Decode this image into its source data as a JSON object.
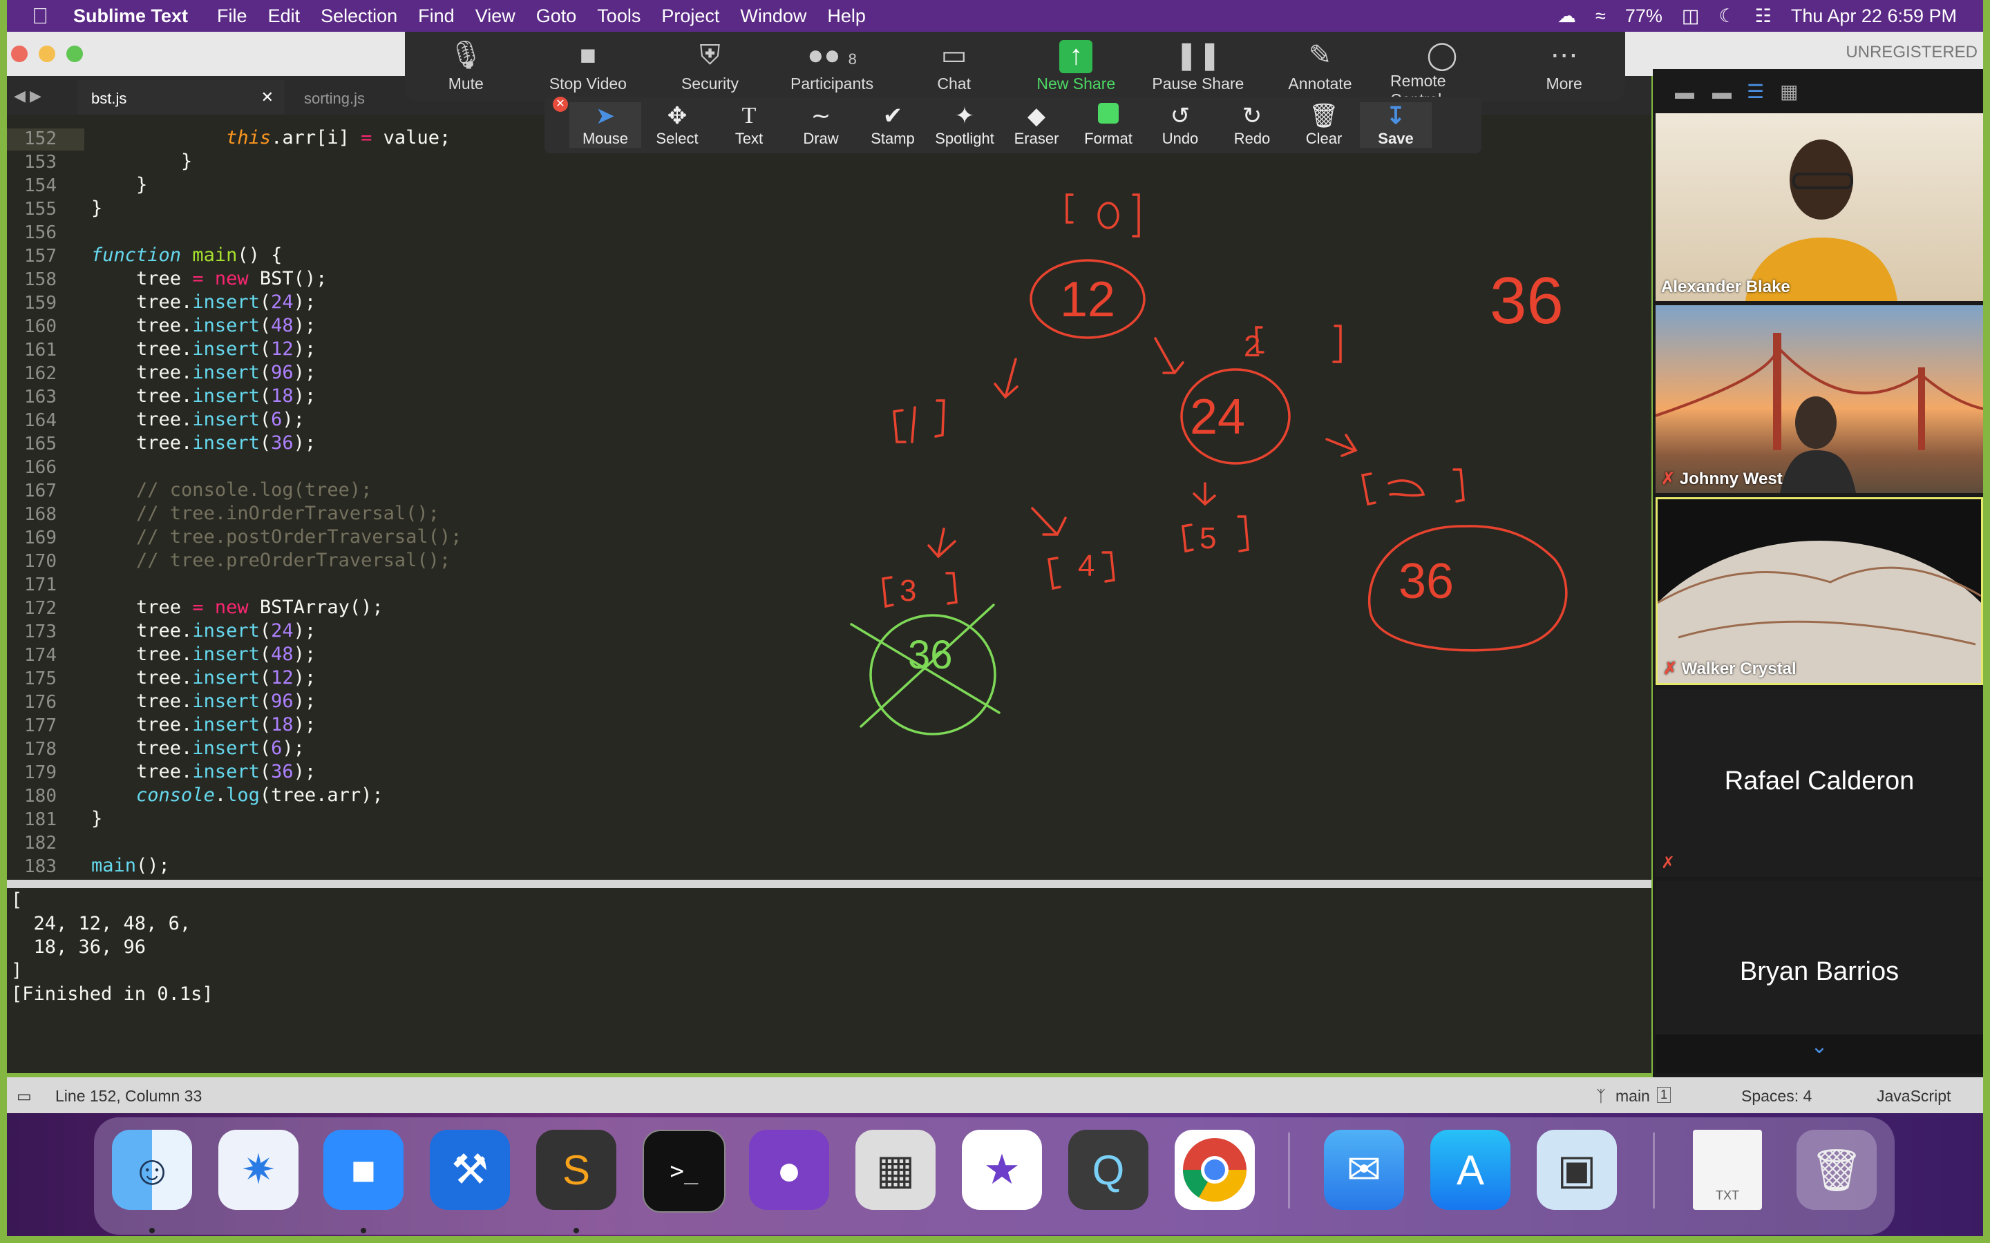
{
  "menubar": {
    "app": "Sublime Text",
    "items": [
      "File",
      "Edit",
      "Selection",
      "Find",
      "View",
      "Goto",
      "Tools",
      "Project",
      "Window",
      "Help"
    ],
    "battery": "77%",
    "datetime": "Thu Apr 22  6:59 PM"
  },
  "window": {
    "unregistered": "UNREGISTERED",
    "tabs": [
      "bst.js",
      "sorting.js"
    ]
  },
  "zoom_toolbar": {
    "items": [
      {
        "label": "Mute",
        "icon": "microphone-icon"
      },
      {
        "label": "Stop Video",
        "icon": "video-camera-icon"
      },
      {
        "label": "Security",
        "icon": "shield-icon"
      },
      {
        "label": "Participants",
        "icon": "participants-icon",
        "count": "8"
      },
      {
        "label": "Chat",
        "icon": "chat-icon"
      },
      {
        "label": "New Share",
        "icon": "share-arrow-icon"
      },
      {
        "label": "Pause Share",
        "icon": "pause-icon"
      },
      {
        "label": "Annotate",
        "icon": "pencil-icon"
      },
      {
        "label": "Remote Control",
        "icon": "mouse-icon"
      },
      {
        "label": "More",
        "icon": "more-dots-icon"
      }
    ]
  },
  "annotate_toolbar": {
    "items": [
      "Mouse",
      "Select",
      "Text",
      "Draw",
      "Stamp",
      "Spotlight",
      "Eraser",
      "Format",
      "Undo",
      "Redo",
      "Clear",
      "Save"
    ]
  },
  "editor": {
    "lines": [
      {
        "n": "152",
        "html": "            <span class='this'>this</span>.arr[i] <span class='kw'>=</span> value;"
      },
      {
        "n": "153",
        "html": "        }"
      },
      {
        "n": "154",
        "html": "    }"
      },
      {
        "n": "155",
        "html": "}"
      },
      {
        "n": "156",
        "html": ""
      },
      {
        "n": "157",
        "html": "<span class='it'>function</span> <span class='fn'>main</span>() {"
      },
      {
        "n": "158",
        "html": "    tree <span class='kw'>=</span> <span class='kw'>new</span> BST();"
      },
      {
        "n": "159",
        "html": "    tree.<span class='mt'>insert</span>(<span class='num'>24</span>);"
      },
      {
        "n": "160",
        "html": "    tree.<span class='mt'>insert</span>(<span class='num'>48</span>);"
      },
      {
        "n": "161",
        "html": "    tree.<span class='mt'>insert</span>(<span class='num'>12</span>);"
      },
      {
        "n": "162",
        "html": "    tree.<span class='mt'>insert</span>(<span class='num'>96</span>);"
      },
      {
        "n": "163",
        "html": "    tree.<span class='mt'>insert</span>(<span class='num'>18</span>);"
      },
      {
        "n": "164",
        "html": "    tree.<span class='mt'>insert</span>(<span class='num'>6</span>);"
      },
      {
        "n": "165",
        "html": "    tree.<span class='mt'>insert</span>(<span class='num'>36</span>);"
      },
      {
        "n": "166",
        "html": ""
      },
      {
        "n": "167",
        "html": "    <span class='cm'>// console.log(tree);</span>"
      },
      {
        "n": "168",
        "html": "    <span class='cm'>// tree.inOrderTraversal();</span>"
      },
      {
        "n": "169",
        "html": "    <span class='cm'>// tree.postOrderTraversal();</span>"
      },
      {
        "n": "170",
        "html": "    <span class='cm'>// tree.preOrderTraversal();</span>"
      },
      {
        "n": "171",
        "html": ""
      },
      {
        "n": "172",
        "html": "    tree <span class='kw'>=</span> <span class='kw'>new</span> BSTArray();"
      },
      {
        "n": "173",
        "html": "    tree.<span class='mt'>insert</span>(<span class='num'>24</span>);"
      },
      {
        "n": "174",
        "html": "    tree.<span class='mt'>insert</span>(<span class='num'>48</span>);"
      },
      {
        "n": "175",
        "html": "    tree.<span class='mt'>insert</span>(<span class='num'>12</span>);"
      },
      {
        "n": "176",
        "html": "    tree.<span class='mt'>insert</span>(<span class='num'>96</span>);"
      },
      {
        "n": "177",
        "html": "    tree.<span class='mt'>insert</span>(<span class='num'>18</span>);"
      },
      {
        "n": "178",
        "html": "    tree.<span class='mt'>insert</span>(<span class='num'>6</span>);"
      },
      {
        "n": "179",
        "html": "    tree.<span class='mt'>insert</span>(<span class='num'>36</span>);"
      },
      {
        "n": "180",
        "html": "    <span class='it'>console</span>.<span class='mt'>log</span>(tree.arr);"
      },
      {
        "n": "181",
        "html": "}"
      },
      {
        "n": "182",
        "html": ""
      },
      {
        "n": "183",
        "html": "<span class='mt'>main</span>();"
      }
    ]
  },
  "annotations": {
    "labels": [
      "[0]",
      "12",
      "[1]",
      "[2]",
      "24",
      "[3]",
      "36",
      "[4]",
      "[5]",
      "[6]",
      "36",
      "36"
    ]
  },
  "output": {
    "lines": [
      "[",
      "  24, 12, 48, 6,",
      "  18, 36, 96",
      "]",
      "[Finished in 0.1s]"
    ]
  },
  "statusbar": {
    "position": "Line 152, Column 33",
    "branch": "main",
    "branch_badge": "1",
    "spaces": "Spaces: 4",
    "syntax": "JavaScript"
  },
  "participants": [
    {
      "name": "Alexander Blake",
      "muted": false
    },
    {
      "name": "Johnny West",
      "muted": true
    },
    {
      "name": "Walker Crystal",
      "muted": true
    },
    {
      "name": "Rafael Calderon",
      "muted": true
    },
    {
      "name": "Bryan Barrios",
      "muted": true
    }
  ],
  "dock": {
    "apps": [
      "Finder",
      "Safari",
      "Zoom",
      "Xcode",
      "Sublime Text",
      "Terminal",
      "GitHub Desktop",
      "Calculator",
      "iMovie",
      "QuickTime Player",
      "Google Chrome",
      "Mail",
      "App Store",
      "Preview",
      "TXT",
      "Trash"
    ],
    "txt_label": "TXT"
  }
}
